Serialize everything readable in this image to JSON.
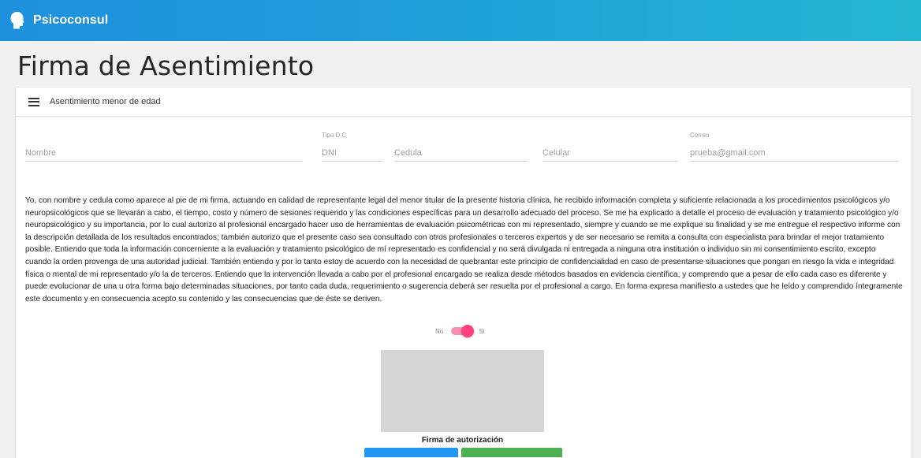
{
  "app": {
    "brand": "Psicoconsul",
    "brand_color": "#1e90dd",
    "logo_icon": "head-silhouette-icon"
  },
  "page": {
    "title": "Firma de Asentimiento"
  },
  "card": {
    "menu_icon": "hamburger-menu-icon",
    "title": "Asentimiento menor de edad"
  },
  "form": {
    "nombre": {
      "label": "",
      "placeholder": "Nombre"
    },
    "tipo_dc": {
      "label": "Tipo D.C",
      "value": "DNI"
    },
    "cedula": {
      "label": "",
      "placeholder": "Cedula"
    },
    "celular": {
      "label": "",
      "placeholder": "Celular"
    },
    "correo": {
      "label": "Correo",
      "value": "prueba@gmail.com"
    }
  },
  "consent_text": "Yo, con nombre y cedula como aparece al pie de mi firma, actuando en calidad de representante legal del menor titular de la presente historia clínica, he recibido información completa y suficiente relacionada a los procedimientos psicológicos y/o neuropsicológicos que se llevarán a cabo, el tiempo, costo y número de sesiones requerido y las condiciones específicas para un desarrollo adecuado del proceso. Se me ha explicado a detalle el proceso de evaluación y tratamiento psicológico y/o neuropsicológico y su importancia, por lo cual autorizo al profesional encargado hacer uso de herramientas de evaluación psicométricas con mi representado, siempre y cuando se me explique su finalidad y se me entregue el respectivo informe con la descripción detallada de los resultados encontrados; también autorizo que el presente caso sea consultado con otros profesionales o terceros expertos y de ser necesario se remita a consulta con especialista para brindar el mejor tratamiento posible. Entiendo que toda la información concerniente a la evaluación y tratamiento psicológico de mí representado es confidencial y no será divulgada ni entregada a ninguna otra institución o individuo sin mi consentimiento escrito, excepto cuando la orden provenga de una autoridad judicial. También entiendo y por lo tanto estoy de acuerdo con la necesidad de quebrantar este principio de confidencialidad en caso de presentarse situaciones que pongan en riesgo la vida e integridad física o mental de mi representado y/o la de terceros. Entiendo que la intervención llevada a cabo por el profesional encargado se realiza desde métodos basados en evidencia científica, y comprendo que a pesar de ello cada caso es diferente y puede evolucionar de una u otra forma bajo determinadas situaciones, por tanto cada duda, requerimiento o sugerencia deberá ser resuelta por el profesional a cargo. En forma expresa manifiesto a ustedes que he leído y comprendido íntegramente este documento y en consecuencia acepto su contenido y las consecuencias que de éste se deriven.",
  "toggle": {
    "off_label": "No",
    "on_label": "Si",
    "checked": true,
    "color": "#ff3f7f"
  },
  "signature": {
    "label": "Firma de autorización",
    "pad_color": "#d6d6d6"
  },
  "buttons": {
    "clear_color": "#2196f3",
    "save_color": "#4caf50"
  }
}
